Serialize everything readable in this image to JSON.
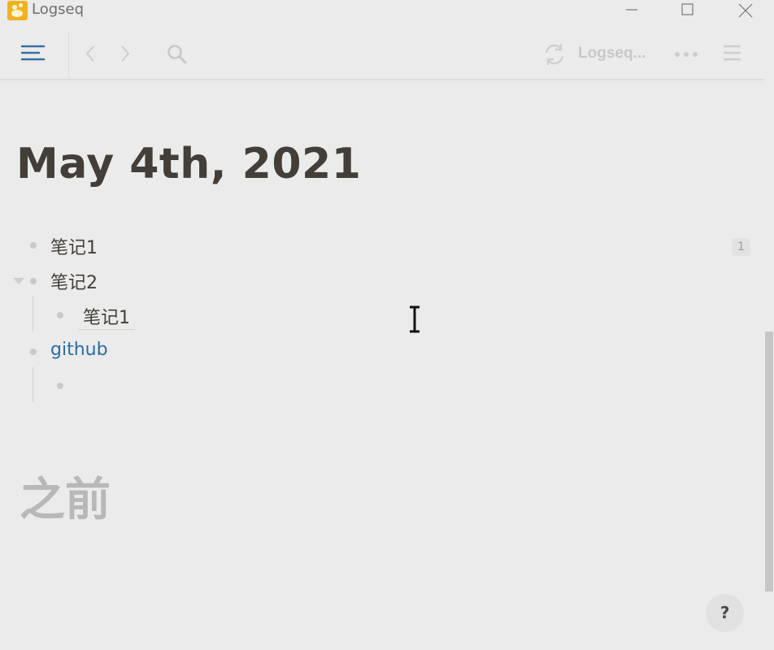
{
  "window": {
    "title": "Logseq",
    "controls": [
      "minimize-icon",
      "maximize-icon",
      "close-icon"
    ]
  },
  "header": {
    "repo_label": "Logseq...",
    "icons": [
      "menu-icon",
      "back-icon",
      "forward-icon",
      "search-icon",
      "sync-icon",
      "more-icon",
      "right-sidebar-icon"
    ]
  },
  "page": {
    "title": "May 4th, 2021",
    "blocks": [
      {
        "text": "笔记1",
        "ref_count": "1"
      },
      {
        "text": "笔记2",
        "children": [
          {
            "text": "笔记1"
          }
        ]
      },
      {
        "text": "github",
        "children": [
          {
            "text": ""
          }
        ]
      }
    ]
  },
  "section": {
    "title": "之前"
  },
  "help": {
    "label": "?"
  },
  "colors": {
    "background": "#ebebeb",
    "text": "#433f38",
    "link": "#2b6d9e",
    "accent": "#3a6fa3",
    "logo": "#f0b21d"
  }
}
